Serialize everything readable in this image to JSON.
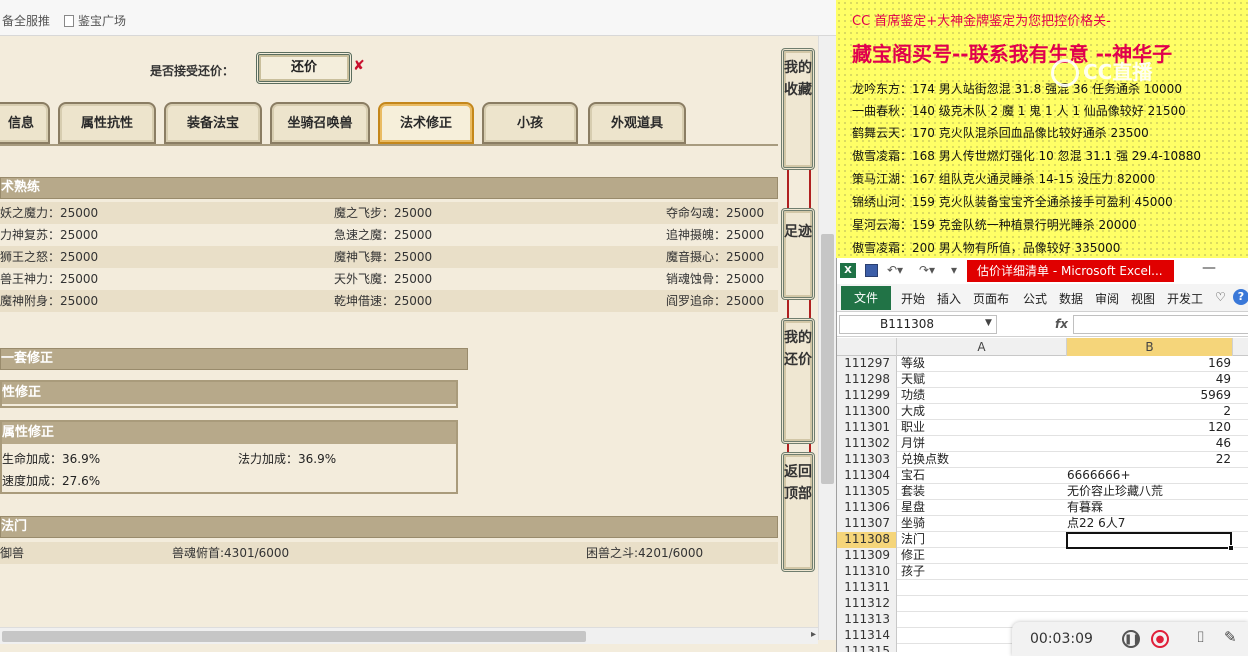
{
  "bookmarks": [
    {
      "label": "备全服推"
    },
    {
      "label": "鉴宝广场"
    }
  ],
  "counter_offer": {
    "label": "是否接受还价：",
    "button": "还价",
    "x_mark": "✘"
  },
  "tabs": [
    {
      "label": "信息"
    },
    {
      "label": "属性抗性"
    },
    {
      "label": "装备法宝"
    },
    {
      "label": "坐骑召唤兽"
    },
    {
      "label": "法术修正",
      "active": true
    },
    {
      "label": "小孩"
    },
    {
      "label": "外观道具"
    }
  ],
  "skill_section": {
    "title": "术熟练",
    "rows": [
      [
        "妖之魔力：25000",
        "魔之飞步：25000",
        "夺命勾魂：25000"
      ],
      [
        "力神复苏：25000",
        "急速之魔：25000",
        "追神摄魄：25000"
      ],
      [
        "狮王之怒：25000",
        "魔神飞舞：25000",
        "魔音摄心：25000"
      ],
      [
        "兽王神力：25000",
        "天外飞魔：25000",
        "销魂蚀骨：25000"
      ],
      [
        "魔神附身：25000",
        "乾坤借速：25000",
        "阎罗追命：25000"
      ]
    ]
  },
  "mod_section": {
    "set_title": "一套修正",
    "attr_title": "性修正",
    "prop_title": "属性修正",
    "prop_rows": [
      [
        "生命加成：36.9%",
        "法力加成：36.9%"
      ],
      [
        "速度加成：27.6%",
        ""
      ]
    ]
  },
  "fa_section": {
    "title": "法门",
    "row": [
      "御兽",
      "兽魂俯首:4301/6000",
      "困兽之斗:4201/6000"
    ]
  },
  "side_buttons": [
    {
      "label": "我的收藏"
    },
    {
      "label": "足迹"
    },
    {
      "label": "我的还价"
    },
    {
      "label": "返回顶部"
    }
  ],
  "note": {
    "line1": "CC 首席鉴定+大神金牌鉴定为您把控价格关-",
    "line2": "藏宝阁买号--联系我有生意 --神华子",
    "watermark": "CC直播",
    "rows": [
      "龙吟东方：174 男人站街忽混 31.8 强混 36 任务通杀 10000",
      "一曲春秋：140 级克木队 2 魔 1 鬼 1 人 1 仙品像较好 21500",
      "鹤舞云天：170 克火队混杀回血品像比较好通杀 23500",
      "傲雪凌霜：168 男人传世燃灯强化 10 忽混 31.1 强 29.4-10880",
      "策马江湖：167 组队克火通灵睡杀 14-15 没压力 82000",
      "锦绣山河：159 克火队装备宝宝齐全通杀接手可盈利 45000",
      "星河云海：159 克金队统一种植景行明光睡杀 20000",
      "傲雪凌霜：200 男人物有所值，品像较好 335000"
    ]
  },
  "excel": {
    "caption": "估价详细清单 - Microsoft Excel...",
    "ribbon_tabs": [
      "开始",
      "插入",
      "页面布",
      "公式",
      "数据",
      "审阅",
      "视图",
      "开发工"
    ],
    "file_tab": "文件",
    "namebox": "B111308",
    "fx": "fx",
    "columns": [
      "A",
      "B"
    ],
    "rows": [
      {
        "n": "111297",
        "a": "等级",
        "b": "169",
        "num": true
      },
      {
        "n": "111298",
        "a": "天赋",
        "b": "49",
        "num": true
      },
      {
        "n": "111299",
        "a": "功绩",
        "b": "5969",
        "num": true
      },
      {
        "n": "111300",
        "a": "大成",
        "b": "2",
        "num": true
      },
      {
        "n": "111301",
        "a": "职业",
        "b": "120",
        "num": true
      },
      {
        "n": "111302",
        "a": "月饼",
        "b": "46",
        "num": true
      },
      {
        "n": "111303",
        "a": "兑换点数",
        "b": "22",
        "num": true
      },
      {
        "n": "111304",
        "a": "宝石",
        "b": "6666666+",
        "num": false
      },
      {
        "n": "111305",
        "a": "套装",
        "b": "无价容止珍藏八荒",
        "num": false
      },
      {
        "n": "111306",
        "a": "星盘",
        "b": "有暮霖",
        "num": false
      },
      {
        "n": "111307",
        "a": "坐骑",
        "b": "点22 6人7",
        "num": false
      },
      {
        "n": "111308",
        "a": "法门",
        "b": "",
        "num": false,
        "selected": true
      },
      {
        "n": "111309",
        "a": "修正",
        "b": "",
        "num": false
      },
      {
        "n": "111310",
        "a": "孩子",
        "b": "",
        "num": false
      },
      {
        "n": "111311",
        "a": "",
        "b": "",
        "num": false
      },
      {
        "n": "111312",
        "a": "",
        "b": "",
        "num": false
      },
      {
        "n": "111313",
        "a": "",
        "b": "",
        "num": false
      },
      {
        "n": "111314",
        "a": "",
        "b": "",
        "num": false
      },
      {
        "n": "111315",
        "a": "",
        "b": "",
        "num": false
      }
    ]
  },
  "recorder": {
    "time": "00:03:09"
  },
  "colors": {
    "accent_red": "#e0004d",
    "excel_green": "#217346",
    "tab_active_border": "#c4871b",
    "note_bg": "#ffff66"
  }
}
